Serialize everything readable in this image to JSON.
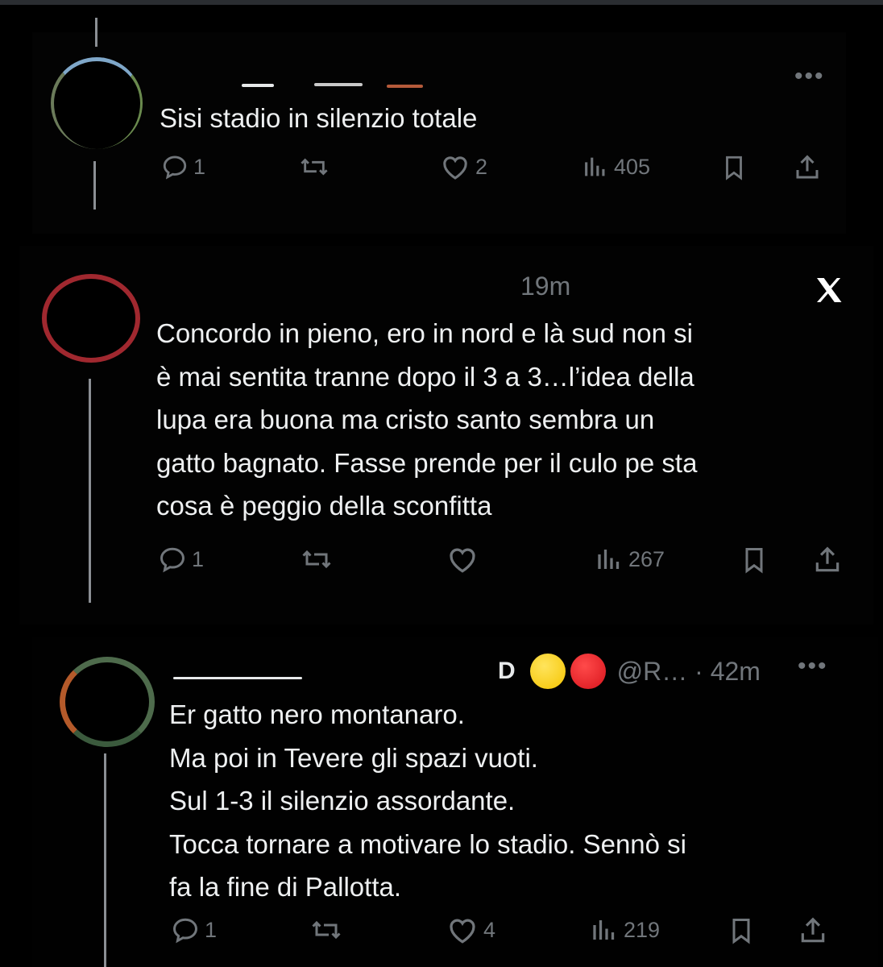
{
  "colors": {
    "background": "#000000",
    "text": "#e7e9ea",
    "muted": "#71767b",
    "thread_line": "#8b8f94",
    "avatar_ring_red": "#a0282f"
  },
  "posts": [
    {
      "text_lines": [
        "Sisi stadio in silenzio totale"
      ],
      "replies": "1",
      "reposts": "",
      "likes": "2",
      "views": "405"
    },
    {
      "timestamp": "19m",
      "text_lines": [
        "Concordo in pieno, ero in nord e là sud non si",
        "è mai sentita tranne dopo il 3 a 3…l’idea della",
        "lupa era buona ma cristo santo sembra un",
        "gatto bagnato. Fasse prende per il culo pe sta",
        "cosa è peggio della sconfitta"
      ],
      "replies": "1",
      "reposts": "",
      "likes": "",
      "views": "267"
    },
    {
      "name_visible_fragment": "D",
      "handle_and_time": "@R… · 42m",
      "text_lines": [
        "Er gatto nero montanaro.",
        "Ma poi in Tevere gli spazi vuoti.",
        "Sul 1-3 il silenzio assordante.",
        "Tocca tornare a motivare lo stadio. Sennò si",
        "fa la fine di Pallotta."
      ],
      "replies": "1",
      "reposts": "",
      "likes": "4",
      "views": "219"
    }
  ],
  "icons": {
    "reply": "reply-icon",
    "repost": "repost-icon",
    "like": "heart-icon",
    "views": "views-icon",
    "bookmark": "bookmark-icon",
    "share": "share-icon",
    "more": "more-icon",
    "x_logo": "x-logo-icon",
    "emoji_yellow": "yellow-circle-emoji",
    "emoji_red": "red-circle-emoji"
  },
  "more_glyph": "•••"
}
